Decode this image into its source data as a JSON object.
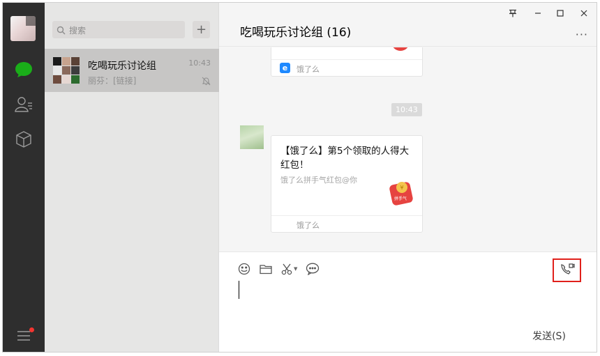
{
  "sidebar": {
    "nav_icons": [
      "chat-icon",
      "contacts-icon",
      "favorites-icon",
      "menu-icon"
    ],
    "accent": "#1aad19"
  },
  "search": {
    "placeholder": "搜索"
  },
  "add_button": {
    "label": "+"
  },
  "chat_list": [
    {
      "title": "吃喝玩乐讨论组",
      "time": "10:43",
      "preview": "丽芬：[链接]",
      "muted": true
    }
  ],
  "conversation": {
    "title": "吃喝玩乐讨论组 (16)",
    "window_controls": {
      "pin": "⽵",
      "minimize": "—",
      "maximize": "□",
      "close": "✕"
    },
    "more": "···",
    "messages": [
      {
        "type": "link-card",
        "source": "饿了么"
      },
      {
        "type": "time",
        "text": "10:43"
      },
      {
        "type": "link-card",
        "title": "【饿了么】第5个领取的人得大红包！",
        "subtitle": "饿了么拼手气红包@你",
        "source": "饿了么",
        "badge": "拼手气"
      }
    ]
  },
  "toolbar": {
    "tools": [
      "emoji-icon",
      "folder-icon",
      "scissors-icon",
      "chat-history-icon",
      "video-call-icon"
    ]
  },
  "send_button": {
    "label": "发送(S)"
  },
  "colors": {
    "rail": "#2e2e2e",
    "list": "#e6e6e5",
    "selected": "#c7c6c5",
    "highlight": "#e0201b",
    "red_packet": "#e64340"
  }
}
